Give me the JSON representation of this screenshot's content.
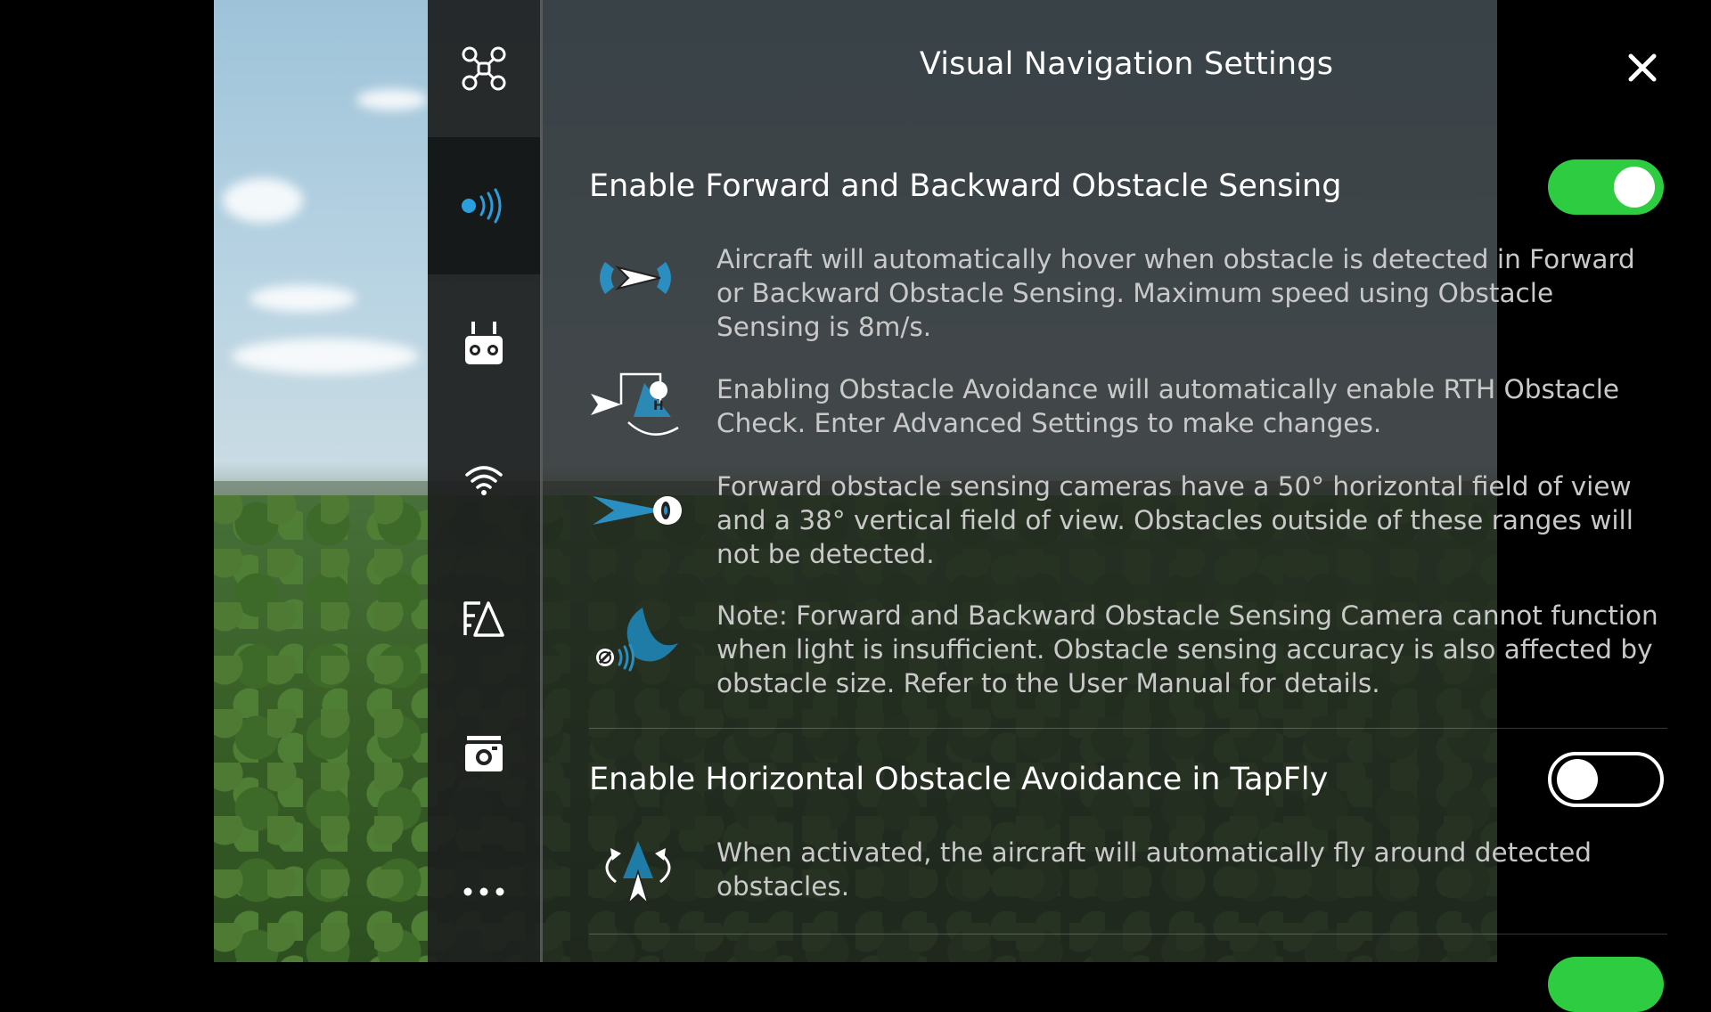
{
  "header": {
    "title": "Visual Navigation Settings"
  },
  "sidebar": {
    "items": [
      {
        "icon": "aircraft-icon",
        "active": false
      },
      {
        "icon": "obstacle-sensing-icon",
        "active": true
      },
      {
        "icon": "remote-controller-icon",
        "active": false
      },
      {
        "icon": "wifi-signal-icon",
        "active": false
      },
      {
        "icon": "battery-icon",
        "active": false
      },
      {
        "icon": "camera-icon",
        "active": false
      },
      {
        "icon": "more-icon",
        "active": false
      }
    ]
  },
  "settings": {
    "forward_backward": {
      "label": "Enable Forward and Backward Obstacle Sensing",
      "enabled": true,
      "notes": [
        {
          "icon": "forward-sensing-icon",
          "text": "Aircraft will automatically hover when obstacle is detected in Forward or Backward Obstacle Sensing. Maximum speed using Obstacle Sensing is 8m/s."
        },
        {
          "icon": "rth-obstacle-check-icon",
          "text": "Enabling Obstacle Avoidance will automatically enable RTH Obstacle Check. Enter Advanced Settings to make changes."
        },
        {
          "icon": "camera-field-of-view-icon",
          "text": "Forward obstacle sensing cameras have a 50° horizontal field of view and a 38° vertical field of view. Obstacles outside of these ranges will not be detected."
        },
        {
          "icon": "low-light-icon",
          "text": "Note: Forward and Backward Obstacle Sensing Camera cannot function when light is insufficient. Obstacle sensing accuracy is also affected by obstacle size. Refer to the User Manual for details."
        }
      ]
    },
    "tapfly": {
      "label": "Enable Horizontal Obstacle Avoidance in TapFly",
      "enabled": false,
      "notes": [
        {
          "icon": "fly-around-icon",
          "text": "When activated, the aircraft will automatically fly around detected obstacles."
        }
      ]
    }
  },
  "colors": {
    "toggle_on": "#2ecc40",
    "accent_blue": "#2a9fe0"
  }
}
